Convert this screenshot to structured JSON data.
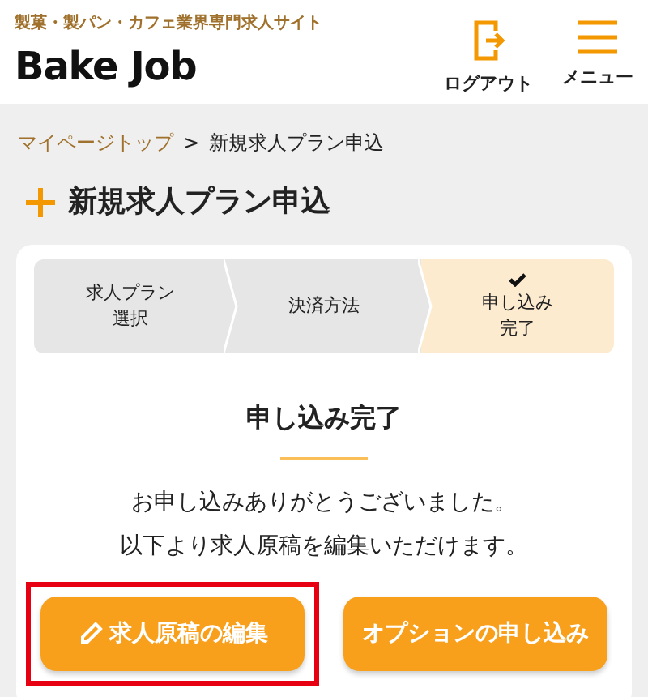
{
  "header": {
    "tagline": "製菓・製パン・カフェ業界専門求人サイト",
    "logo": "Bake Job",
    "actions": [
      {
        "label": "ログアウト",
        "kind": "logout"
      },
      {
        "label": "メニュー",
        "kind": "menu"
      }
    ]
  },
  "breadcrumb": {
    "link": "マイページトップ",
    "separator": ">",
    "current": "新規求人プラン申込"
  },
  "page_title": "新規求人プラン申込",
  "steps": [
    {
      "label": [
        "求人プラン",
        "選択"
      ],
      "selected": false
    },
    {
      "label": [
        "決済方法"
      ],
      "selected": false
    },
    {
      "label": [
        "申し込み",
        "完了"
      ],
      "selected": true
    }
  ],
  "heading": "申し込み完了",
  "message": [
    "お申し込みありがとうございました。",
    "以下より求人原稿を編集いただけます。"
  ],
  "buttons": [
    {
      "label": "求人原稿の編集",
      "kind": "edit",
      "highlighted": true
    },
    {
      "label": "オプションの申し込み",
      "kind": "plain",
      "highlighted": false
    }
  ]
}
